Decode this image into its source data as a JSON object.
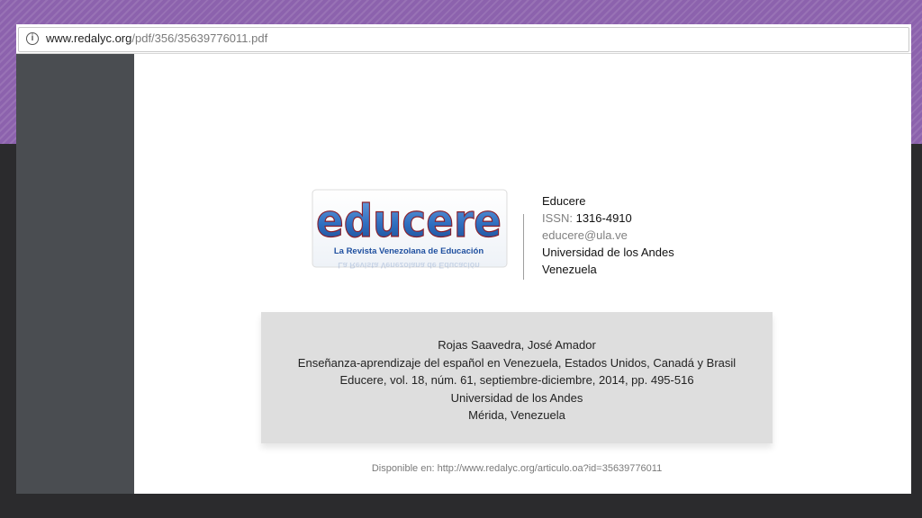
{
  "browser": {
    "url_host": "www.redalyc.org",
    "url_path": "/pdf/356/35639776011.pdf"
  },
  "journal": {
    "logo_text": "educere",
    "logo_subtitle": "La Revista Venezolana de Educación",
    "name": "Educere",
    "issn_label": "ISSN:",
    "issn": "1316-4910",
    "email": "educere@ula.ve",
    "university": "Universidad de los Andes",
    "country": "Venezuela"
  },
  "citation": {
    "author": "Rojas Saavedra, José Amador",
    "title": "Enseñanza-aprendizaje del español en Venezuela, Estados Unidos, Canadá y Brasil",
    "source": "Educere, vol. 18, núm. 61, septiembre-diciembre, 2014, pp. 495-516",
    "institution": "Universidad de los Andes",
    "location": "Mérida, Venezuela"
  },
  "footer": {
    "available_at": "Disponible en: http://www.redalyc.org/articulo.oa?id=35639776011"
  },
  "colors": {
    "band": "#8c62ad",
    "background": "#2b2b2d",
    "sidebar": "#4a4d51",
    "logo_blue": "#2f6fc0",
    "logo_text_blue": "#1e4f9f"
  }
}
